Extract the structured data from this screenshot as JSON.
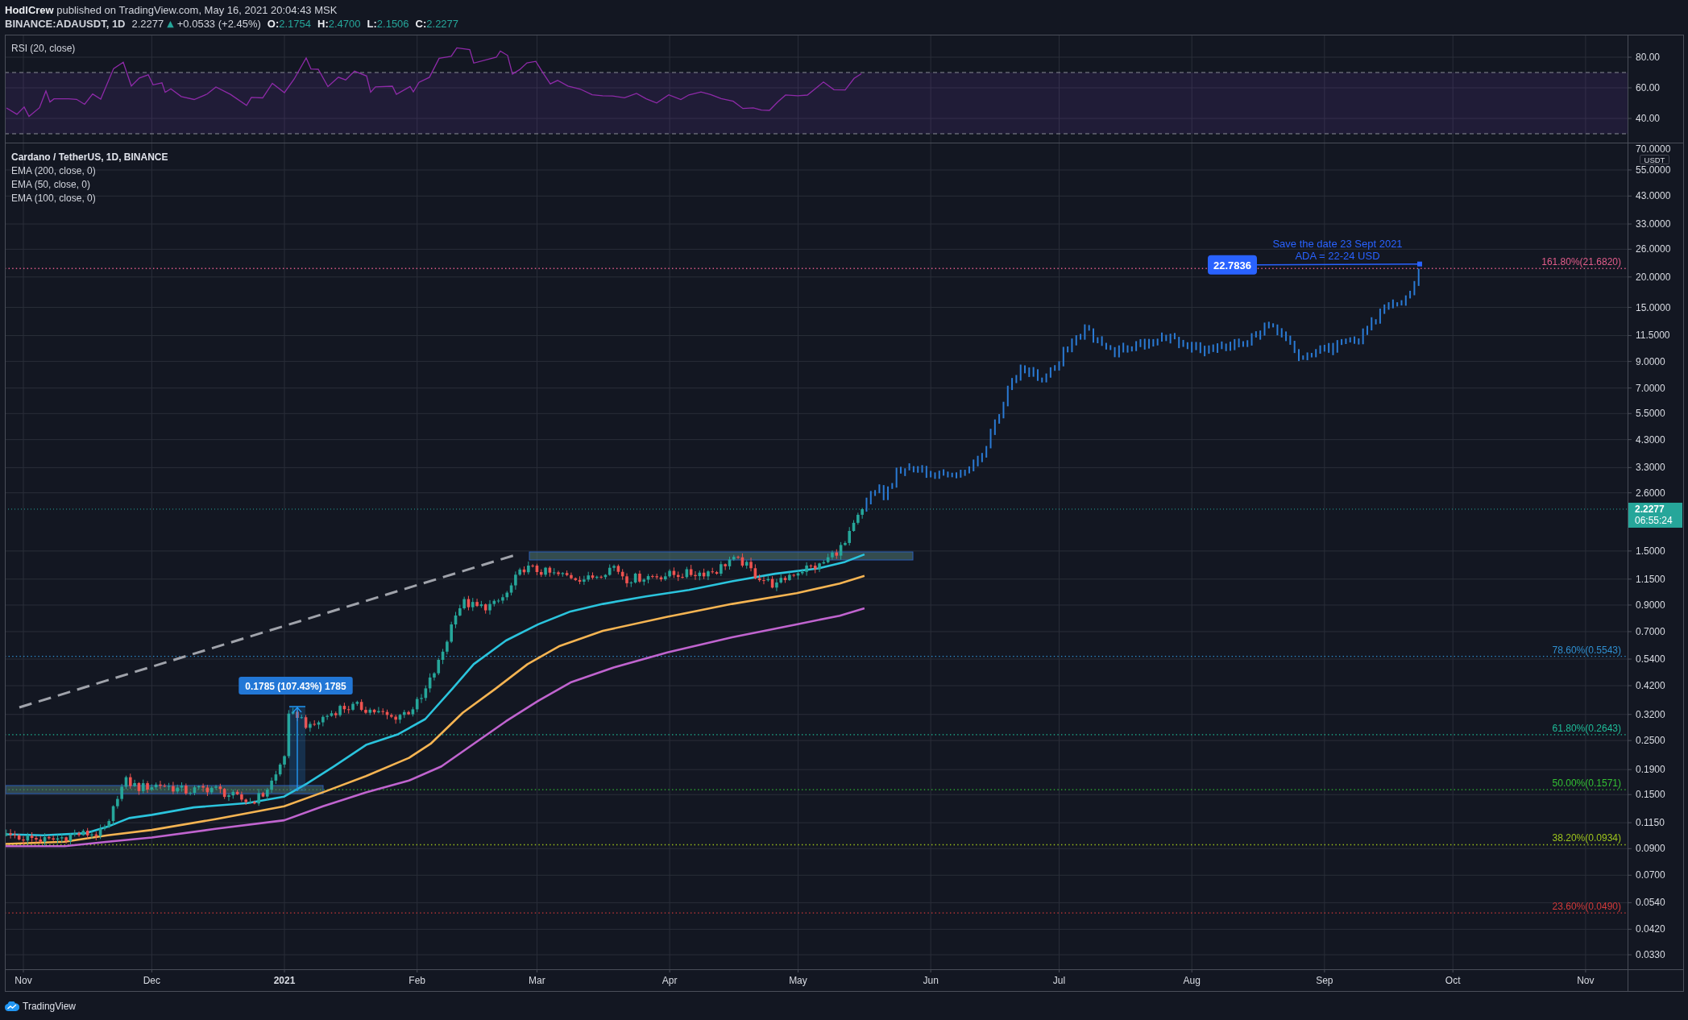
{
  "header": {
    "published": "**HodlCrew** published on TradingView.com, May 16, 2021 20:04:43 MSK"
  },
  "symbol_bar": {
    "symbol": "BINANCE:ADAUSDT, 1D",
    "last": "2.2277",
    "change_arrow": "▲",
    "change": "+0.0533 (+2.45%)",
    "ohlc": [
      {
        "label": "O:",
        "value": "2.1754"
      },
      {
        "label": "H:",
        "value": "2.4700"
      },
      {
        "label": "L:",
        "value": "2.1506"
      },
      {
        "label": "C:",
        "value": "2.2277"
      }
    ]
  },
  "rsi_pane": {
    "title": "RSI (20, close)",
    "axis_labels": [
      "80.00",
      "60.00",
      "40.00"
    ]
  },
  "price_pane": {
    "title": "Cardano / TetherUS, 1D, BINANCE",
    "indicators": [
      "EMA (200, close, 0)",
      "EMA (50, close, 0)",
      "EMA (100, close, 0)"
    ],
    "currency": "USDT",
    "axis_labels": [
      "70.0000",
      "55.0000",
      "43.0000",
      "33.0000",
      "26.0000",
      "20.0000",
      "15.0000",
      "11.5000",
      "9.0000",
      "7.0000",
      "5.5000",
      "4.3000",
      "3.3000",
      "2.6000",
      "1.5000",
      "1.1500",
      "0.9000",
      "0.7000",
      "0.5400",
      "0.4200",
      "0.3200",
      "0.2500",
      "0.1900",
      "0.1500",
      "0.1150",
      "0.0900",
      "0.0700",
      "0.0540",
      "0.0420",
      "0.0330"
    ],
    "last_price": {
      "price": "2.2277",
      "countdown": "06:55:24"
    },
    "fib_levels": [
      {
        "label": "161.80%(21.6820)",
        "color": "#e35d8b"
      },
      {
        "label": "78.60%(0.5543)",
        "color": "#2f8fd0"
      },
      {
        "label": "61.80%(0.2643)",
        "color": "#1ebc98"
      },
      {
        "label": "50.00%(0.1571)",
        "color": "#34c034"
      },
      {
        "label": "38.20%(0.0934)",
        "color": "#9ec41c"
      },
      {
        "label": "23.60%(0.0490)",
        "color": "#d33a3a"
      }
    ],
    "measure": {
      "label": "0.1785 (107.43%) 1785"
    },
    "target": {
      "price": "22.7836",
      "note": [
        "Save the date 23 Sept 2021",
        "ADA = 22-24 USD"
      ]
    }
  },
  "time_axis": [
    {
      "label": "Nov",
      "kind": "month"
    },
    {
      "label": "Dec",
      "kind": "month"
    },
    {
      "label": "2021",
      "kind": "year"
    },
    {
      "label": "Feb",
      "kind": "month"
    },
    {
      "label": "Mar",
      "kind": "month"
    },
    {
      "label": "Apr",
      "kind": "month"
    },
    {
      "label": "May",
      "kind": "month"
    },
    {
      "label": "Jun",
      "kind": "month"
    },
    {
      "label": "Jul",
      "kind": "month"
    },
    {
      "label": "Aug",
      "kind": "month"
    },
    {
      "label": "Sep",
      "kind": "month"
    },
    {
      "label": "Oct",
      "kind": "month"
    },
    {
      "label": "Nov",
      "kind": "month"
    }
  ],
  "footer": {
    "brand": "TradingView"
  }
}
